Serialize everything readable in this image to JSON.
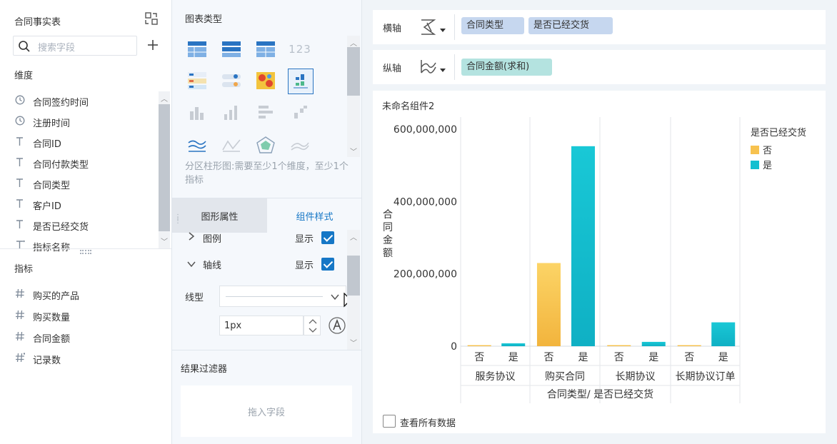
{
  "left_panel": {
    "title": "合同事实表",
    "search_placeholder": "搜索字段",
    "dimension_title": "维度",
    "dimensions": [
      {
        "label": "合同签约时间",
        "icon": "clock-icon"
      },
      {
        "label": "注册时间",
        "icon": "clock-icon"
      },
      {
        "label": "合同ID",
        "icon": "text-type-icon"
      },
      {
        "label": "合同付款类型",
        "icon": "text-type-icon"
      },
      {
        "label": "合同类型",
        "icon": "text-type-icon"
      },
      {
        "label": "客户ID",
        "icon": "text-type-icon"
      },
      {
        "label": "是否已经交货",
        "icon": "text-type-icon"
      },
      {
        "label": "指标名称",
        "icon": "text-type-calc-icon"
      }
    ],
    "metric_title": "指标",
    "metrics": [
      {
        "label": "购买的产品",
        "icon": "hash-icon"
      },
      {
        "label": "购买数量",
        "icon": "hash-icon"
      },
      {
        "label": "合同金额",
        "icon": "hash-icon"
      },
      {
        "label": "记录数",
        "icon": "hash-calc-icon"
      }
    ]
  },
  "mid_panel": {
    "chart_type_title": "图表类型",
    "chart_hint": "分区柱形图:需要至少1个维度，至少1个指标",
    "tabs": [
      "图形属性",
      "组件样式"
    ],
    "active_tab": 1,
    "legend_row": {
      "label": "图例",
      "toggle_label": "显示"
    },
    "axis_row": {
      "label": "轴线",
      "toggle_label": "显示"
    },
    "line_type_label": "线型",
    "line_width_value": "1px",
    "filter_title": "结果过滤器",
    "filter_drop_text": "拖入字段"
  },
  "right_panel": {
    "x_axis_label": "横轴",
    "x_pills": [
      "合同类型",
      "是否已经交货"
    ],
    "y_axis_label": "纵轴",
    "y_pills": [
      "合同金额(求和)"
    ],
    "chart_title": "未命名组件2",
    "view_all_label": "查看所有数据"
  },
  "colors": {
    "accent": "#1677c6",
    "series_no": "#f7c24f",
    "series_yes": "#13bfd0",
    "dim_pill": "#c6d7ef",
    "metric_pill": "#b4e3e0"
  },
  "chart_data": {
    "type": "bar",
    "title": "",
    "xlabel": "合同类型/ 是否已经交货",
    "ylabel": "合同金额",
    "ylim": [
      0,
      600000000
    ],
    "yticks": [
      "600,000,000",
      "400,000,000",
      "200,000,000",
      "0"
    ],
    "ytick_values": [
      600000000,
      400000000,
      200000000,
      0
    ],
    "categories": [
      "服务协议",
      "购买合同",
      "长期协议",
      "长期协议订单"
    ],
    "sub_categories": [
      "否",
      "是"
    ],
    "legend_title": "是否已经交货",
    "series": [
      {
        "name": "否",
        "color": "#f7c24f",
        "values": [
          1500000,
          230000000,
          3000000,
          1000000
        ]
      },
      {
        "name": "是",
        "color": "#13bfd0",
        "values": [
          8000000,
          553000000,
          12000000,
          66000000
        ]
      }
    ]
  }
}
